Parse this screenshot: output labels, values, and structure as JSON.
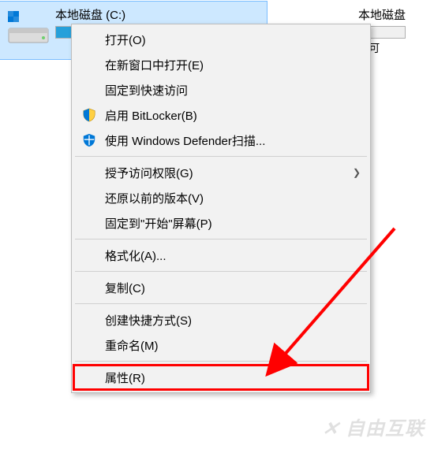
{
  "drives": {
    "c": {
      "label": "本地磁盘 (C:)",
      "fill_pct": 12
    },
    "d": {
      "label": "本地磁盘",
      "sub": "B 可"
    }
  },
  "menu": {
    "open": "打开(O)",
    "new_window": "在新窗口中打开(E)",
    "pin_quick": "固定到快速访问",
    "bitlocker": "启用 BitLocker(B)",
    "defender": "使用 Windows Defender扫描...",
    "grant": "授予访问权限(G)",
    "restore": "还原以前的版本(V)",
    "pin_start": "固定到\"开始\"屏幕(P)",
    "format": "格式化(A)...",
    "copy": "复制(C)",
    "shortcut": "创建快捷方式(S)",
    "rename": "重命名(M)",
    "properties": "属性(R)"
  },
  "watermark": "自由互联"
}
